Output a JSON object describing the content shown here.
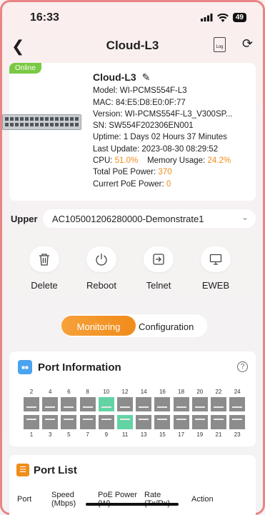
{
  "status": {
    "time": "16:33",
    "battery": "49"
  },
  "nav": {
    "title": "Cloud-L3",
    "log_label": "Log"
  },
  "device": {
    "badge": "Online",
    "name": "Cloud-L3",
    "model": "Model: WI-PCMS554F-L3",
    "mac": "MAC: 84:E5:D8:E0:0F:77",
    "version": "Version: WI-PCMS554F-L3_V300SP...",
    "sn": "SN: SW554F202306EN001",
    "uptime": "Uptime: 1 Days 02 Hours 37 Minutes",
    "last_update": "Last Update: 2023-08-30 08:29:52",
    "cpu_label": "CPU:",
    "cpu_value": "51.0%",
    "mem_label": "Memory Usage:",
    "mem_value": "24.2%",
    "poe_total_label": "Total PoE Power:",
    "poe_total_value": "370",
    "poe_current_label": "Currert PoE Power:",
    "poe_current_value": "0"
  },
  "upper": {
    "label": "Upper",
    "value": "AC105001206280000-Demonstrate1"
  },
  "actions": [
    {
      "label": "Delete",
      "icon": "trash-icon"
    },
    {
      "label": "Reboot",
      "icon": "power-icon"
    },
    {
      "label": "Telnet",
      "icon": "telnet-icon"
    },
    {
      "label": "EWEB",
      "icon": "monitor-icon"
    }
  ],
  "tabs": {
    "active": "Monitoring",
    "other": "Configuration"
  },
  "port_info": {
    "title": "Port Information",
    "top_numbers": [
      "2",
      "4",
      "6",
      "8",
      "10",
      "12",
      "14",
      "16",
      "18",
      "20",
      "22",
      "24"
    ],
    "bottom_numbers": [
      "1",
      "3",
      "5",
      "7",
      "9",
      "11",
      "13",
      "15",
      "17",
      "19",
      "21",
      "23"
    ],
    "active_ports": [
      "10",
      "11"
    ],
    "colors": {
      "active": "#62d4a4",
      "inactive": "#8c8c8c"
    }
  },
  "port_list": {
    "title": "Port List",
    "columns": [
      "Port",
      "Speed (Mbps)",
      "PoE Power (W)",
      "Rate (Tx/Rx)",
      "Action"
    ]
  },
  "colors": {
    "accent": "#f08c1a",
    "online": "#7ac943",
    "frame": "#e98585"
  }
}
